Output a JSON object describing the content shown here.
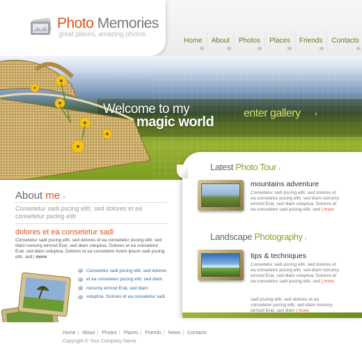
{
  "brand": {
    "name_part1": "Photo",
    "name_part2": "Memories",
    "slogan": "great places, amazing photos"
  },
  "nav": {
    "items": [
      {
        "label": "Home"
      },
      {
        "label": "About"
      },
      {
        "label": "Photos"
      },
      {
        "label": "Places"
      },
      {
        "label": "Friends"
      },
      {
        "label": "Contacts"
      }
    ]
  },
  "banner": {
    "welcome_line1": "Welcome to my",
    "welcome_line2": "magic world",
    "enter_gallery": "enter gallery",
    "enter_arrow": "›"
  },
  "about": {
    "title_part1": "About",
    "title_part2": "me",
    "title_arrow": "›",
    "intro": "Consetetur sadi pscing elitr, sed dolores et ea consetetur pscing elitr",
    "subtitle": "dolores et ea consetetur sadi",
    "body": "Consetetur sadi pscing elitr, sed dolores et ea consetetur pscing elitr, sed diam nonumy eirmod Erat, sed diam voluptua. Dolores et ea consetetur Erat, sed diam voluptua. Dolores et ea consetetur lorem ipsum sadi pscing elitr, sed",
    "more": "more",
    "bullets": [
      "Consetetur sadi pscing elitr, sed dolores",
      "et ea consetetur pscing elitr, sed diam",
      "nonumy eirmod Erat, sed diam",
      "voluptua. Dolores et ea consetetur sadi"
    ]
  },
  "tour": {
    "title_part1": "Latest",
    "title_part2": "Photo Tour",
    "title_arrow": "›",
    "item_title": "mountains adventure",
    "item_body": "Consetetur sadi pscing elitr, sed dolores et ea consetetur pscing elitr, sed diam nonumy eirmod Erat, sed diam voluptua. Dolores et ea consetetur sadi pscing elitr, sed",
    "more": "more"
  },
  "landscape": {
    "title_part1": "Landscape",
    "title_part2": "Photography",
    "title_arrow": "›",
    "item_title": "tips & techniques",
    "item_body": "Consetetur sadi pscing elitr, sed dolores et ea consetetur pscing elitr, sed diam nonumy eirmod Erat, sed diam voluptua. Dolores et ea consetetur sadi pscing elitr, sed",
    "more": "more",
    "extra_body": "sadi pscing elitr, sed dolores et ea consetetur pscing elitr, sed diam nonumy eirmod Erat, sed diam",
    "extra_more": "more"
  },
  "footer": {
    "links": [
      "Home",
      "About",
      "Photos",
      "Places",
      "Friends",
      "News",
      "Contacts"
    ],
    "copyright": "Copyright © Your Company Name"
  },
  "colors": {
    "accent_orange": "#d9541e",
    "accent_green": "#8aa02a",
    "nav_text": "#6b7a2a",
    "link_blue": "#2d6aa0"
  }
}
